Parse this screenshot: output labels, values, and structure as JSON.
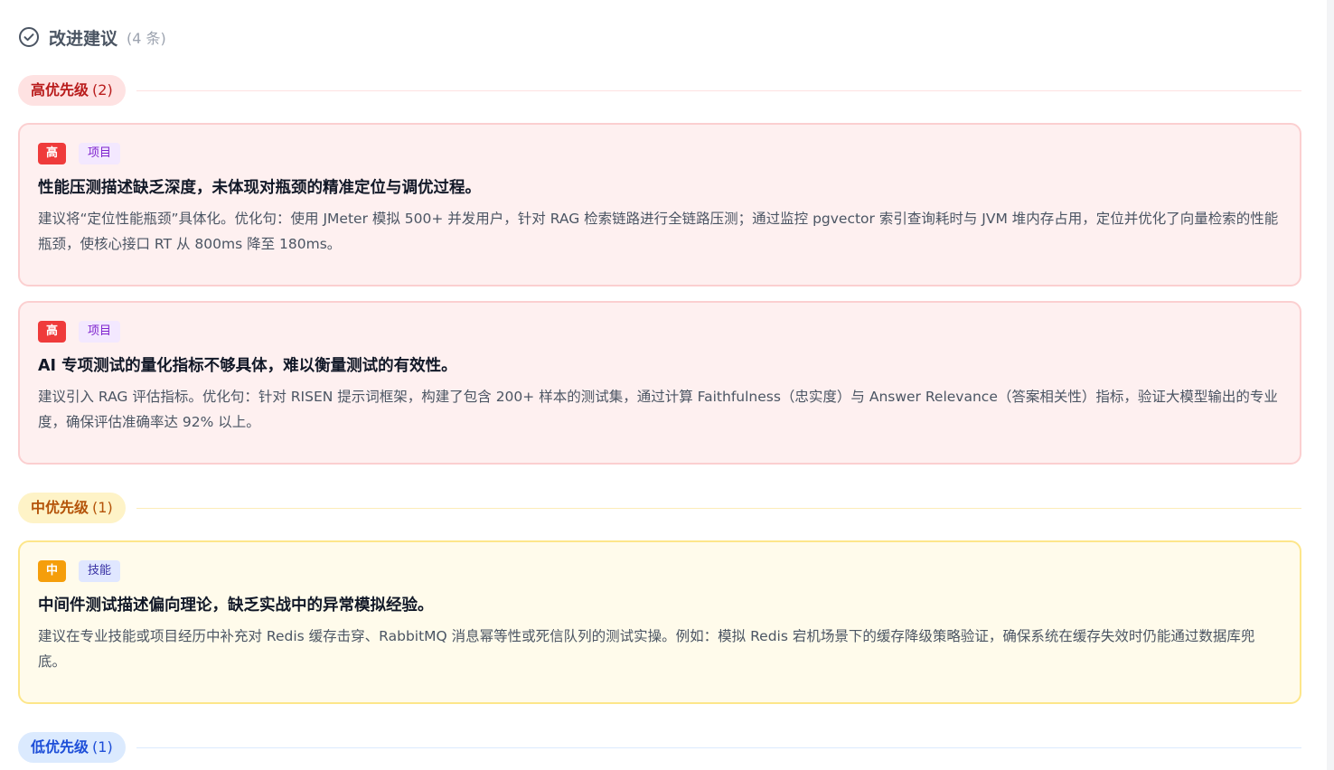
{
  "header": {
    "title": "改进建议",
    "count": "(4 条)"
  },
  "groups": {
    "high": {
      "label": "高优先级",
      "count": "(2)",
      "items": [
        {
          "level": "高",
          "category": "项目",
          "title": "性能压测描述缺乏深度，未体现对瓶颈的精准定位与调优过程。",
          "body": "建议将“定位性能瓶颈”具体化。优化句：使用 JMeter 模拟 500+ 并发用户，针对 RAG 检索链路进行全链路压测；通过监控 pgvector 索引查询耗时与 JVM 堆内存占用，定位并优化了向量检索的性能瓶颈，使核心接口 RT 从 800ms 降至 180ms。"
        },
        {
          "level": "高",
          "category": "项目",
          "title": "AI 专项测试的量化指标不够具体，难以衡量测试的有效性。",
          "body": "建议引入 RAG 评估指标。优化句：针对 RISEN 提示词框架，构建了包含 200+ 样本的测试集，通过计算 Faithfulness（忠实度）与 Answer Relevance（答案相关性）指标，验证大模型输出的专业度，确保评估准确率达 92% 以上。"
        }
      ]
    },
    "mid": {
      "label": "中优先级",
      "count": "(1)",
      "items": [
        {
          "level": "中",
          "category": "技能",
          "title": "中间件测试描述偏向理论，缺乏实战中的异常模拟经验。",
          "body": "建议在专业技能或项目经历中补充对 Redis 缓存击穿、RabbitMQ 消息幂等性或死信队列的测试实操。例如：模拟 Redis 宕机场景下的缓存降级策略验证，确保系统在缓存失效时仍能通过数据库兜底。"
        }
      ]
    },
    "low": {
      "label": "低优先级",
      "count": "(1)"
    }
  },
  "colors": {
    "high": "#ef3b3b",
    "mid": "#f59e0b",
    "low": "#1d4ed8"
  }
}
